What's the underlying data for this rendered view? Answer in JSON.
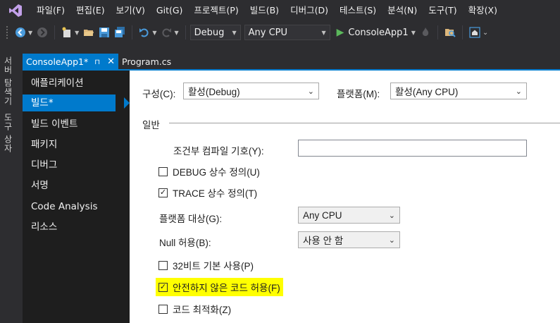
{
  "menubar": {
    "items": [
      "파일(F)",
      "편집(E)",
      "보기(V)",
      "Git(G)",
      "프로젝트(P)",
      "빌드(B)",
      "디버그(D)",
      "테스트(S)",
      "분석(N)",
      "도구(T)",
      "확장(X)"
    ]
  },
  "toolbar": {
    "configuration": "Debug",
    "platform": "Any CPU",
    "run_target": "ConsoleApp1"
  },
  "siderail": {
    "tab1": "서버 탐색기",
    "tab2": "도구 상자"
  },
  "tabs": {
    "active": "ConsoleApp1*",
    "active_pin": "⊓",
    "active_close": "✕",
    "second": "Program.cs"
  },
  "nav": {
    "items": [
      "애플리케이션",
      "빌드*",
      "빌드 이벤트",
      "패키지",
      "디버그",
      "서명",
      "Code Analysis",
      "리소스"
    ],
    "selected_index": 1
  },
  "build": {
    "config_label": "구성(C):",
    "config_value": "활성(Debug)",
    "platform_label": "플랫폼(M):",
    "platform_value": "활성(Any CPU)",
    "section_general": "일반",
    "conditional_symbols_label": "조건부 컴파일 기호(Y):",
    "conditional_symbols_value": "",
    "define_debug": {
      "label": "DEBUG 상수 정의(U)",
      "checked": false
    },
    "define_trace": {
      "label": "TRACE 상수 정의(T)",
      "checked": true
    },
    "platform_target_label": "플랫폼 대상(G):",
    "platform_target_value": "Any CPU",
    "nullable_label": "Null 허용(B):",
    "nullable_value": "사용 안 함",
    "prefer32": {
      "label": "32비트 기본 사용(P)",
      "checked": false
    },
    "allow_unsafe": {
      "label": "안전하지 않은 코드 허용(F)",
      "checked": true
    },
    "optimize": {
      "label": "코드 최적화(Z)",
      "checked": false
    }
  },
  "colors": {
    "accent": "#007acc",
    "highlight": "#ffff00",
    "chrome": "#2d2d30",
    "nav_bg": "#1e1e1e"
  }
}
